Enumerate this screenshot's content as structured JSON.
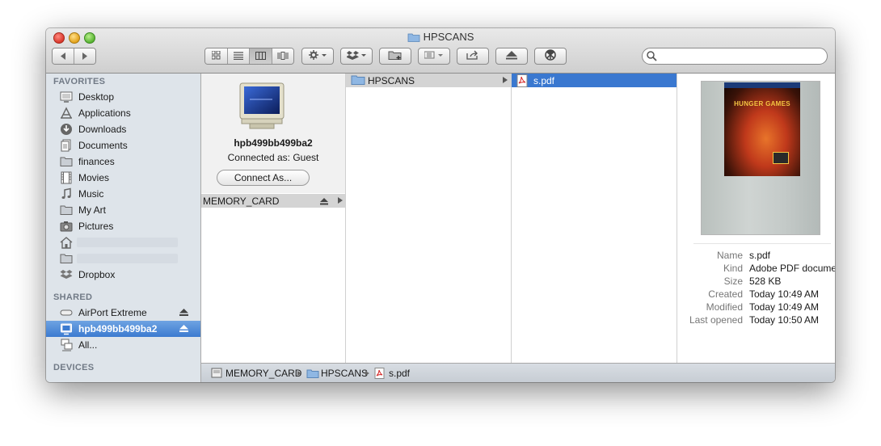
{
  "window": {
    "title": "HPSCANS"
  },
  "toolbar": {
    "view_modes": [
      "icon-view",
      "list-view",
      "column-view",
      "coverflow-view"
    ],
    "active_view": "column-view",
    "search_placeholder": ""
  },
  "sidebar": {
    "favorites_header": "FAVORITES",
    "favorites": [
      {
        "label": "Desktop",
        "icon": "desktop-icon"
      },
      {
        "label": "Applications",
        "icon": "applications-icon"
      },
      {
        "label": "Downloads",
        "icon": "downloads-icon"
      },
      {
        "label": "Documents",
        "icon": "documents-icon"
      },
      {
        "label": "finances",
        "icon": "folder-icon"
      },
      {
        "label": "Movies",
        "icon": "movies-icon"
      },
      {
        "label": "Music",
        "icon": "music-icon"
      },
      {
        "label": "My Art",
        "icon": "folder-icon"
      },
      {
        "label": "Pictures",
        "icon": "camera-icon"
      },
      {
        "label": "",
        "icon": "home-icon"
      },
      {
        "label": "",
        "icon": "folder-icon"
      },
      {
        "label": "Dropbox",
        "icon": "dropbox-icon"
      }
    ],
    "shared_header": "SHARED",
    "shared": [
      {
        "label": "AirPort Extreme",
        "icon": "airport-icon"
      },
      {
        "label": "hpb499bb499ba2",
        "icon": "monitor-icon",
        "selected": true
      },
      {
        "label": "All...",
        "icon": "network-icon"
      }
    ],
    "devices_header": "DEVICES"
  },
  "server": {
    "name": "hpb499bb499ba2",
    "connected_as": "Connected as: Guest",
    "connect_button": "Connect As..."
  },
  "columns": {
    "col1_item": "MEMORY_CARD",
    "col2_item": "HPSCANS",
    "col3_item": "s.pdf"
  },
  "preview": {
    "cover_title": "HUNGER GAMES",
    "info": [
      {
        "key": "Name",
        "value": "s.pdf"
      },
      {
        "key": "Kind",
        "value": "Adobe PDF document"
      },
      {
        "key": "Size",
        "value": "528 KB"
      },
      {
        "key": "Created",
        "value": "Today 10:49 AM"
      },
      {
        "key": "Modified",
        "value": "Today 10:49 AM"
      },
      {
        "key": "Last opened",
        "value": "Today 10:50 AM"
      }
    ]
  },
  "pathbar": {
    "crumbs": [
      "MEMORY_CARD",
      "HPSCANS",
      "s.pdf"
    ]
  },
  "colors": {
    "selection": "#3a78d0",
    "sidebar_bg": "#dee4ea"
  }
}
